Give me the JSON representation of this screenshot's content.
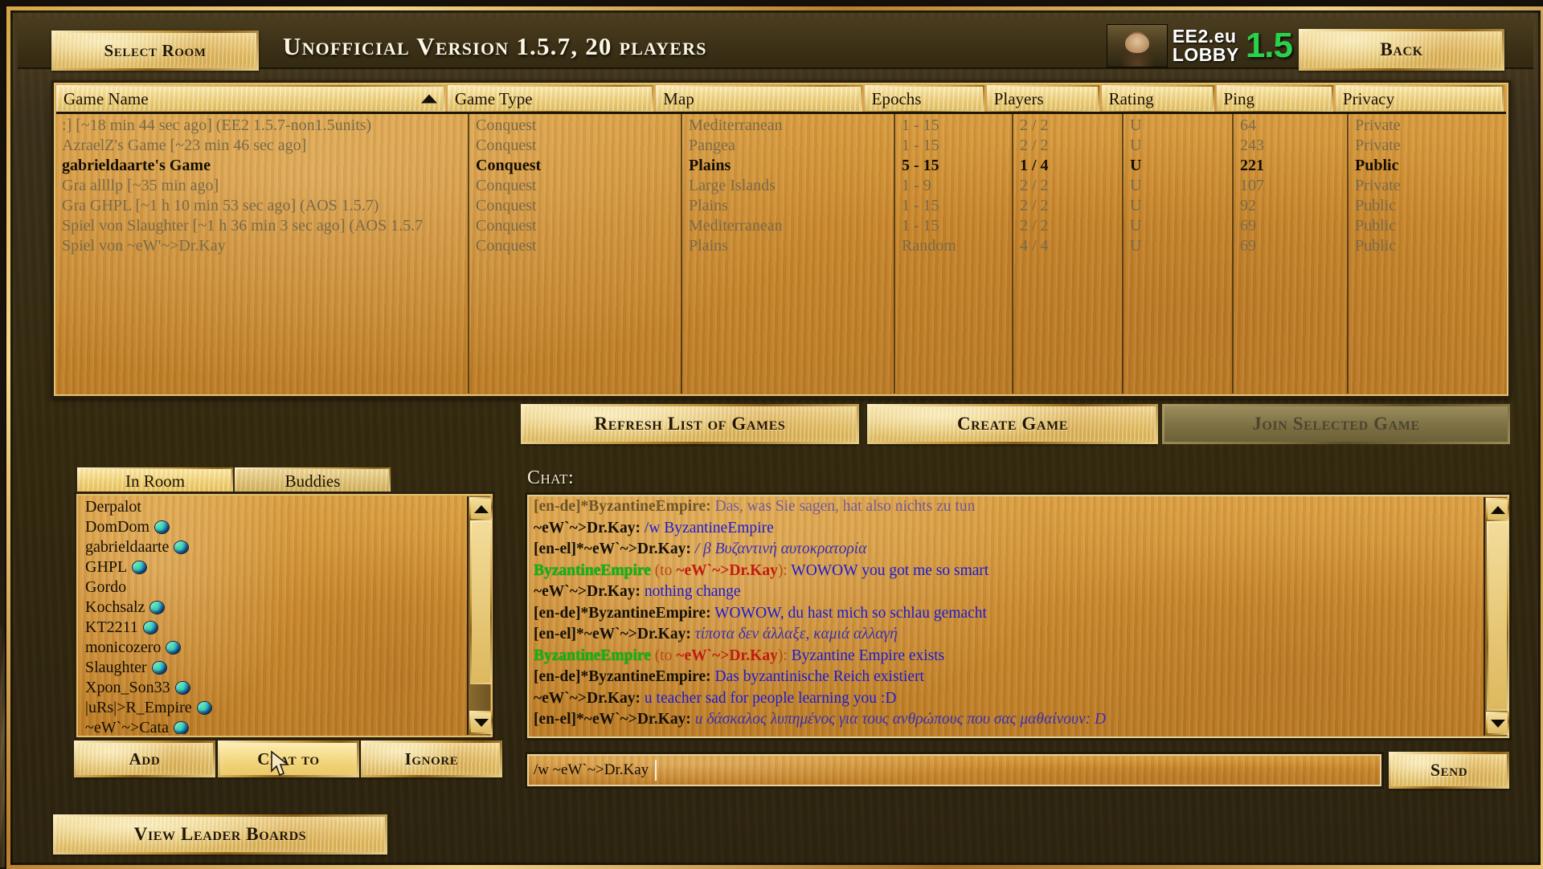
{
  "window": {
    "title": "Unofficial Version 1.5.7, 20 players",
    "select_room_label": "Select Room",
    "back_label": "Back"
  },
  "logo": {
    "line1": "EE2.eu",
    "line2": "LOBBY",
    "version": "1.5",
    "version_color": "#2bd14a",
    "portrait_icon": "mona-lisa-icon"
  },
  "games_table": {
    "columns": [
      {
        "key": "name",
        "label": "Game Name",
        "sorted": true,
        "sort_dir": "asc"
      },
      {
        "key": "type",
        "label": "Game Type"
      },
      {
        "key": "map",
        "label": "Map"
      },
      {
        "key": "epochs",
        "label": "Epochs"
      },
      {
        "key": "players",
        "label": "Players"
      },
      {
        "key": "rating",
        "label": "Rating"
      },
      {
        "key": "ping",
        "label": "Ping"
      },
      {
        "key": "privacy",
        "label": "Privacy"
      }
    ],
    "rows": [
      {
        "name": ":] [~18 min 44 sec ago] (EE2 1.5.7-non1.5units)",
        "type": "Conquest",
        "map": "Mediterranean",
        "epochs": "1 - 15",
        "players": "2 / 2",
        "rating": "U",
        "ping": "64",
        "privacy": "Private",
        "selected": false
      },
      {
        "name": "AzraelZ's Game [~23 min 46 sec ago]",
        "type": "Conquest",
        "map": "Pangea",
        "epochs": "1 - 15",
        "players": "2 / 2",
        "rating": "U",
        "ping": "243",
        "privacy": "Private",
        "selected": false
      },
      {
        "name": "gabrieldaarte's Game",
        "type": "Conquest",
        "map": "Plains",
        "epochs": "5 - 15",
        "players": "1 / 4",
        "rating": "U",
        "ping": "221",
        "privacy": "Public",
        "selected": true
      },
      {
        "name": "Gra allllp [~35 min ago]",
        "type": "Conquest",
        "map": "Large Islands",
        "epochs": "1 - 9",
        "players": "2 / 2",
        "rating": "U",
        "ping": "107",
        "privacy": "Private",
        "selected": false
      },
      {
        "name": "Gra GHPL [~1 h 10 min 53 sec ago] (AOS 1.5.7)",
        "type": "Conquest",
        "map": "Plains",
        "epochs": "1 - 15",
        "players": "2 / 2",
        "rating": "U",
        "ping": "92",
        "privacy": "Public",
        "selected": false
      },
      {
        "name": "Spiel von Slaughter [~1 h 36 min 3 sec ago] (AOS 1.5.7",
        "type": "Conquest",
        "map": "Mediterranean",
        "epochs": "1 - 15",
        "players": "2 / 2",
        "rating": "U",
        "ping": "69",
        "privacy": "Public",
        "selected": false
      },
      {
        "name": "Spiel von ~eW'~>Dr.Kay",
        "type": "Conquest",
        "map": "Plains",
        "epochs": "Random",
        "players": "4 / 4",
        "rating": "U",
        "ping": "69",
        "privacy": "Public",
        "selected": false
      }
    ]
  },
  "actions": {
    "refresh_label": "Refresh List of Games",
    "create_label": "Create Game",
    "join_label": "Join Selected Game",
    "join_disabled": true
  },
  "players_panel": {
    "tabs": [
      {
        "label": "In Room",
        "active": true
      },
      {
        "label": "Buddies",
        "active": false
      }
    ],
    "players": [
      {
        "name": "Derpalot",
        "globe": false
      },
      {
        "name": "DomDom",
        "globe": true
      },
      {
        "name": "gabrieldaarte",
        "globe": true
      },
      {
        "name": "GHPL",
        "globe": true
      },
      {
        "name": "Gordo",
        "globe": false
      },
      {
        "name": "Kochsalz",
        "globe": true
      },
      {
        "name": "KT2211",
        "globe": true
      },
      {
        "name": "monicozero",
        "globe": true
      },
      {
        "name": "Slaughter",
        "globe": true
      },
      {
        "name": "Xpon_Son33",
        "globe": true
      },
      {
        "name": "|uRs|>R_Empire",
        "globe": true
      },
      {
        "name": "~eW`~>Cata",
        "globe": true
      }
    ],
    "buttons": {
      "add_label": "Add",
      "chat_to_label": "Chat to",
      "ignore_label": "Ignore"
    }
  },
  "chat": {
    "label": "Chat:",
    "lines": [
      {
        "faded": true,
        "nick": "[en-de]*ByzantineEmpire:",
        "nick_style": "black",
        "msg": "Das, was Sie sagen, hat also nichts zu tun",
        "msg_style": "blue"
      },
      {
        "faded": false,
        "nick": "~eW`~>Dr.Kay:",
        "nick_style": "black",
        "msg": "/w ByzantineEmpire",
        "msg_style": "blue"
      },
      {
        "faded": false,
        "nick": "[en-el]*~eW`~>Dr.Kay:",
        "nick_style": "black",
        "msg": "/ β Βυζαντινή αυτοκρατορία",
        "msg_style": "greek"
      },
      {
        "faded": false,
        "nick": "ByzantineEmpire",
        "nick_style": "green",
        "to_prefix": " (to ",
        "to_name": "~eW`~>Dr.Kay",
        "to_suffix": "):",
        "msg": "WOWOW you got me so smart",
        "msg_style": "blue"
      },
      {
        "faded": false,
        "nick": "~eW`~>Dr.Kay:",
        "nick_style": "black",
        "msg": "nothing change",
        "msg_style": "blue"
      },
      {
        "faded": false,
        "nick": "[en-de]*ByzantineEmpire:",
        "nick_style": "black",
        "msg": "WOWOW, du hast mich so schlau gemacht",
        "msg_style": "blue"
      },
      {
        "faded": false,
        "nick": "[en-el]*~eW`~>Dr.Kay:",
        "nick_style": "black",
        "msg": "τίποτα δεν άλλαξε, καμιά αλλαγή",
        "msg_style": "greek"
      },
      {
        "faded": false,
        "nick": "ByzantineEmpire",
        "nick_style": "green",
        "to_prefix": " (to ",
        "to_name": "~eW`~>Dr.Kay",
        "to_suffix": "):",
        "msg": "Byzantine Empire exists",
        "msg_style": "blue"
      },
      {
        "faded": false,
        "nick": "[en-de]*ByzantineEmpire:",
        "nick_style": "black",
        "msg": "Das byzantinische Reich existiert",
        "msg_style": "blue"
      },
      {
        "faded": false,
        "nick": "~eW`~>Dr.Kay:",
        "nick_style": "black",
        "msg": "u teacher sad for people learning you :D",
        "msg_style": "blue"
      },
      {
        "faded": false,
        "nick": "[en-el]*~eW`~>Dr.Kay:",
        "nick_style": "black",
        "msg": "u δάσκαλος λυπημένος για τους ανθρώπους που σας μαθαίνουν: D",
        "msg_style": "greek"
      }
    ],
    "input_value": "/w ~eW`~>Dr.Kay",
    "send_label": "Send"
  },
  "footer": {
    "leaderboards_label": "View Leader Boards"
  },
  "colors": {
    "accent_gold": "#e3c068",
    "panel_wood": "#c9872c",
    "chat_blue": "#1d1bd2",
    "chat_green": "#0bb80b",
    "chat_red": "#c21b0f",
    "version_green": "#2bd14a"
  }
}
